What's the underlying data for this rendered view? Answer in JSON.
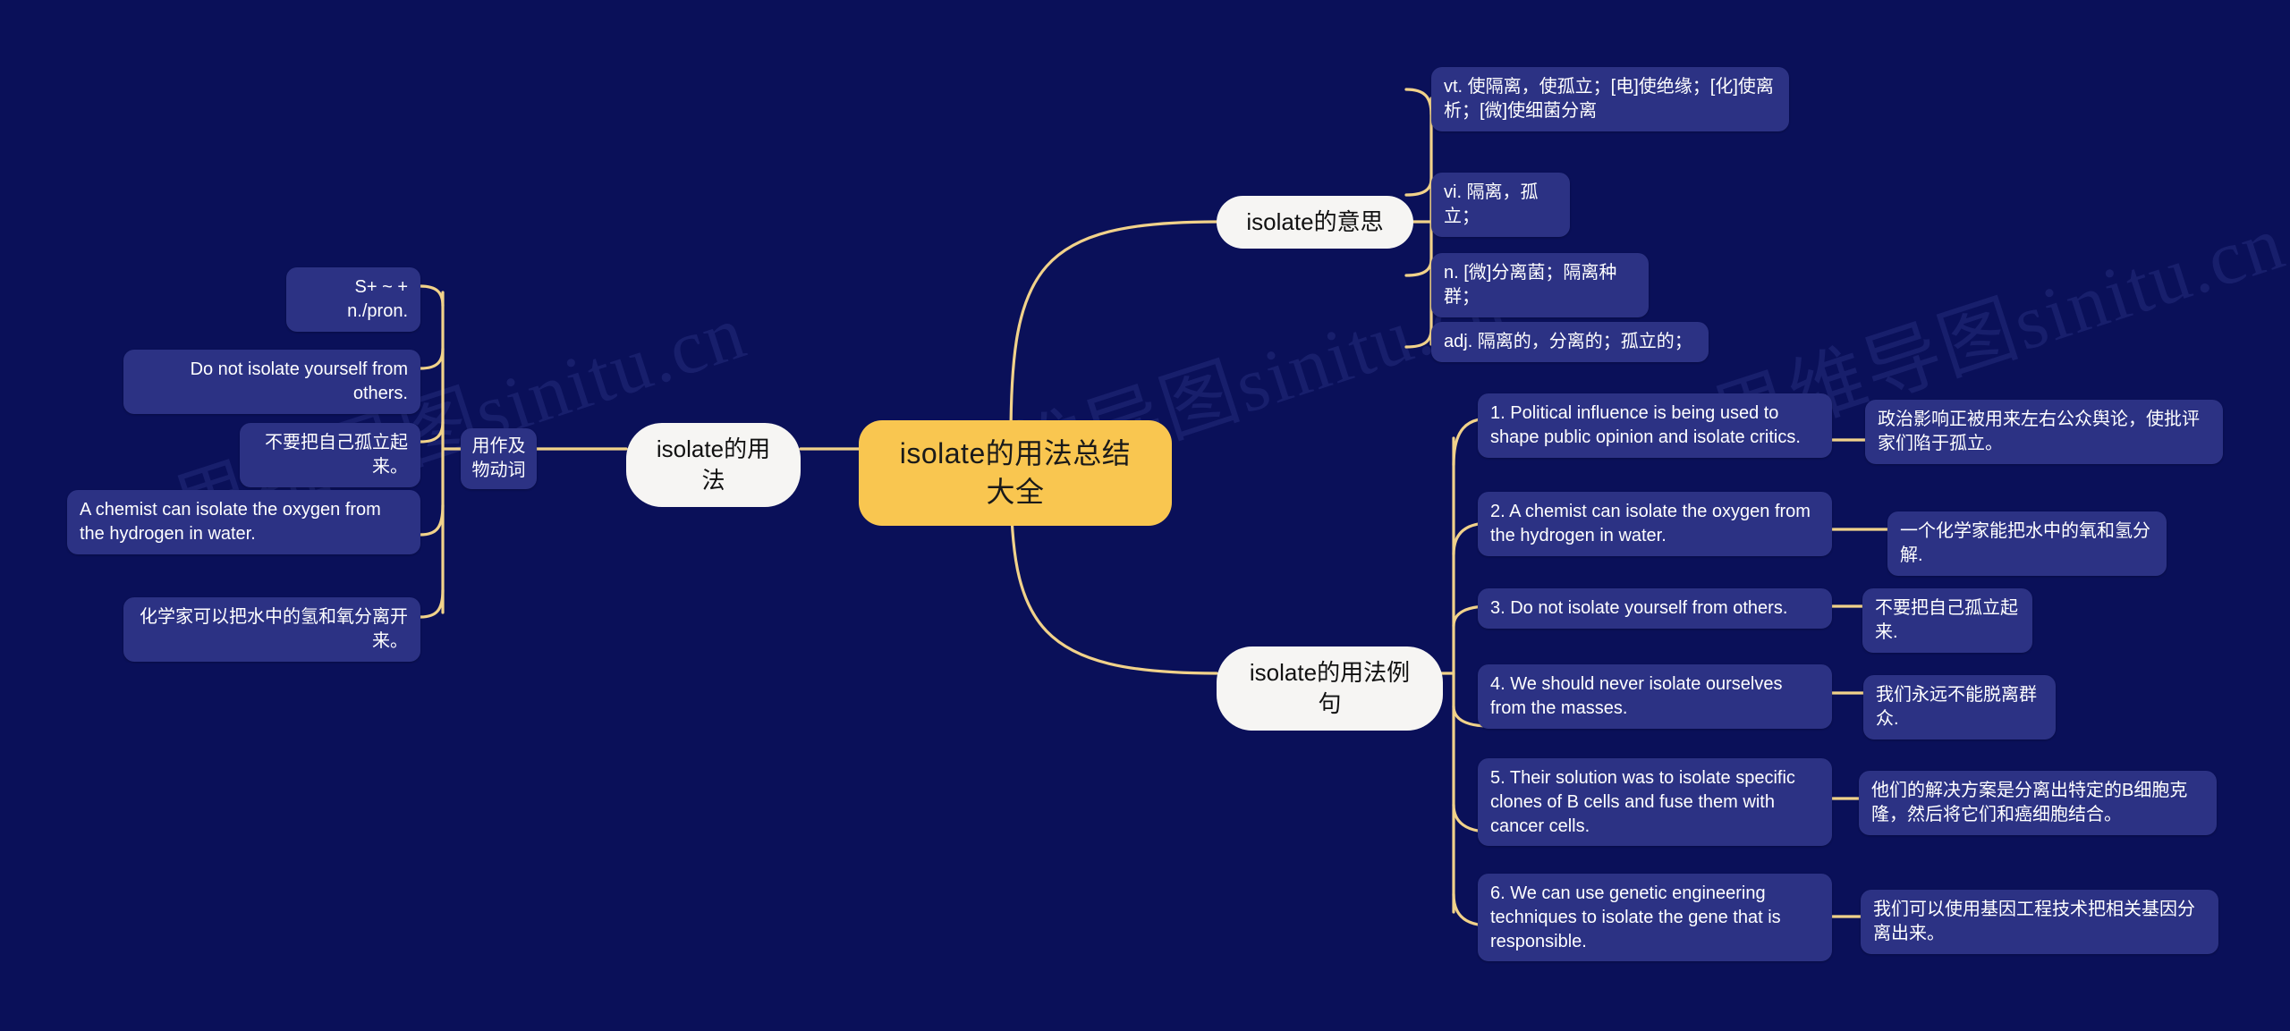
{
  "theme": {
    "background": "#0a1059",
    "node_fill": "#2c3284",
    "branch_fill": "#f6f5f3",
    "root_fill": "#f9c650",
    "link_color": "#f1d28a",
    "text_color": "#ffffff"
  },
  "watermark": {
    "text": "思维导图sinitu.cn"
  },
  "root": {
    "label": "isolate的用法总结大全"
  },
  "branches": {
    "usage": {
      "label": "isolate的用法",
      "sub": {
        "label": "用作及物动词",
        "items": [
          {
            "text": "S+ ~ + n./pron."
          },
          {
            "text": "Do not isolate yourself from others."
          },
          {
            "text": "不要把自己孤立起来。"
          },
          {
            "text": "A chemist can isolate the oxygen from the hydrogen in water."
          },
          {
            "text": "化学家可以把水中的氢和氧分离开来。"
          }
        ]
      }
    },
    "meaning": {
      "label": "isolate的意思",
      "items": [
        {
          "text": "vt. 使隔离，使孤立；[电]使绝缘；[化]使离析；[微]使细菌分离"
        },
        {
          "text": "vi. 隔离，孤立；"
        },
        {
          "text": "n. [微]分离菌；隔离种群；"
        },
        {
          "text": "adj. 隔离的，分离的；孤立的；"
        }
      ]
    },
    "examples": {
      "label": "isolate的用法例句",
      "items": [
        {
          "en": "1. Political influence is being used to shape public opinion and isolate critics.",
          "zh": "政治影响正被用来左右公众舆论，使批评家们陷于孤立。"
        },
        {
          "en": "2. A chemist can isolate the oxygen from the hydrogen in water.",
          "zh": "一个化学家能把水中的氧和氢分解."
        },
        {
          "en": "3. Do not isolate yourself from others.",
          "zh": "不要把自己孤立起来."
        },
        {
          "en": "4. We should never isolate ourselves from the masses.",
          "zh": "我们永远不能脱离群众."
        },
        {
          "en": "5. Their solution was to isolate specific clones of B cells and fuse them with cancer cells.",
          "zh": "他们的解决方案是分离出特定的B细胞克隆，然后将它们和癌细胞结合。"
        },
        {
          "en": "6. We can use genetic engineering techniques to isolate the gene that is responsible.",
          "zh": "我们可以使用基因工程技术把相关基因分离出来。"
        }
      ]
    }
  }
}
